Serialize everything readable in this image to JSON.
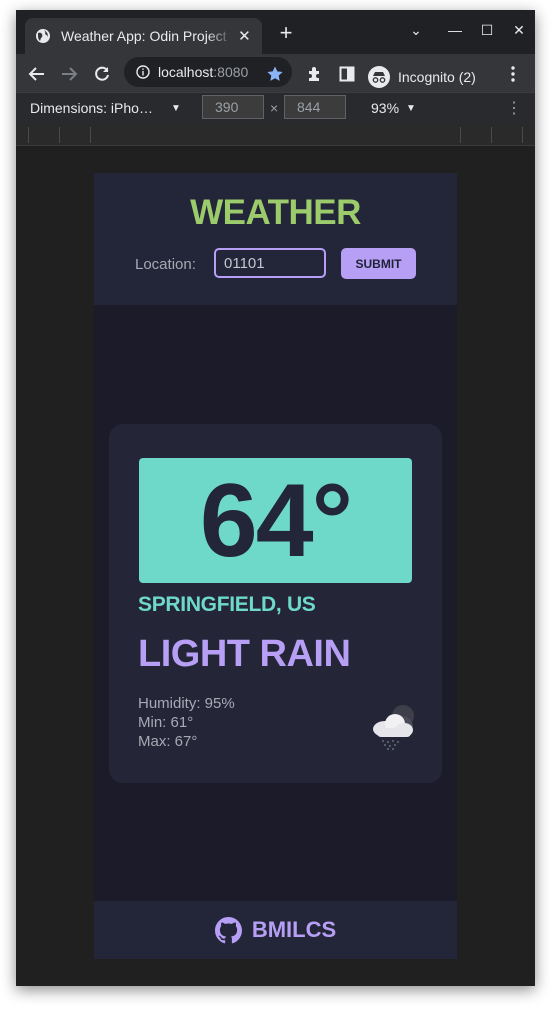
{
  "browser": {
    "tab_title": "Weather App: Odin Project",
    "tab_close": "✕",
    "new_tab": "+",
    "window_controls": {
      "menu": "⌄",
      "minimize": "—",
      "maximize": "☐",
      "close": "✕"
    },
    "url_host": "localhost",
    "url_port": ":8080",
    "profile_label": "Incognito (2)"
  },
  "devtools": {
    "device_label": "Dimensions: iPho…",
    "width": "390",
    "height": "844",
    "times": "×",
    "zoom": "93%"
  },
  "app": {
    "title": "WEATHER",
    "location_label": "Location:",
    "location_value": "01101",
    "submit_label": "SUBMIT",
    "temperature": "64°",
    "city": "SPRINGFIELD, US",
    "condition": "LIGHT RAIN",
    "humidity": "Humidity: 95%",
    "min": "Min: 61°",
    "max": "Max: 67°",
    "weather_icon": "cloud-rain-icon",
    "footer_name": "BMILCS",
    "colors": {
      "accent_green": "#9ccb6b",
      "accent_teal": "#6ed9c8",
      "accent_purple": "#b69ff5",
      "background": "#1c1b29",
      "panel": "#232538"
    }
  }
}
